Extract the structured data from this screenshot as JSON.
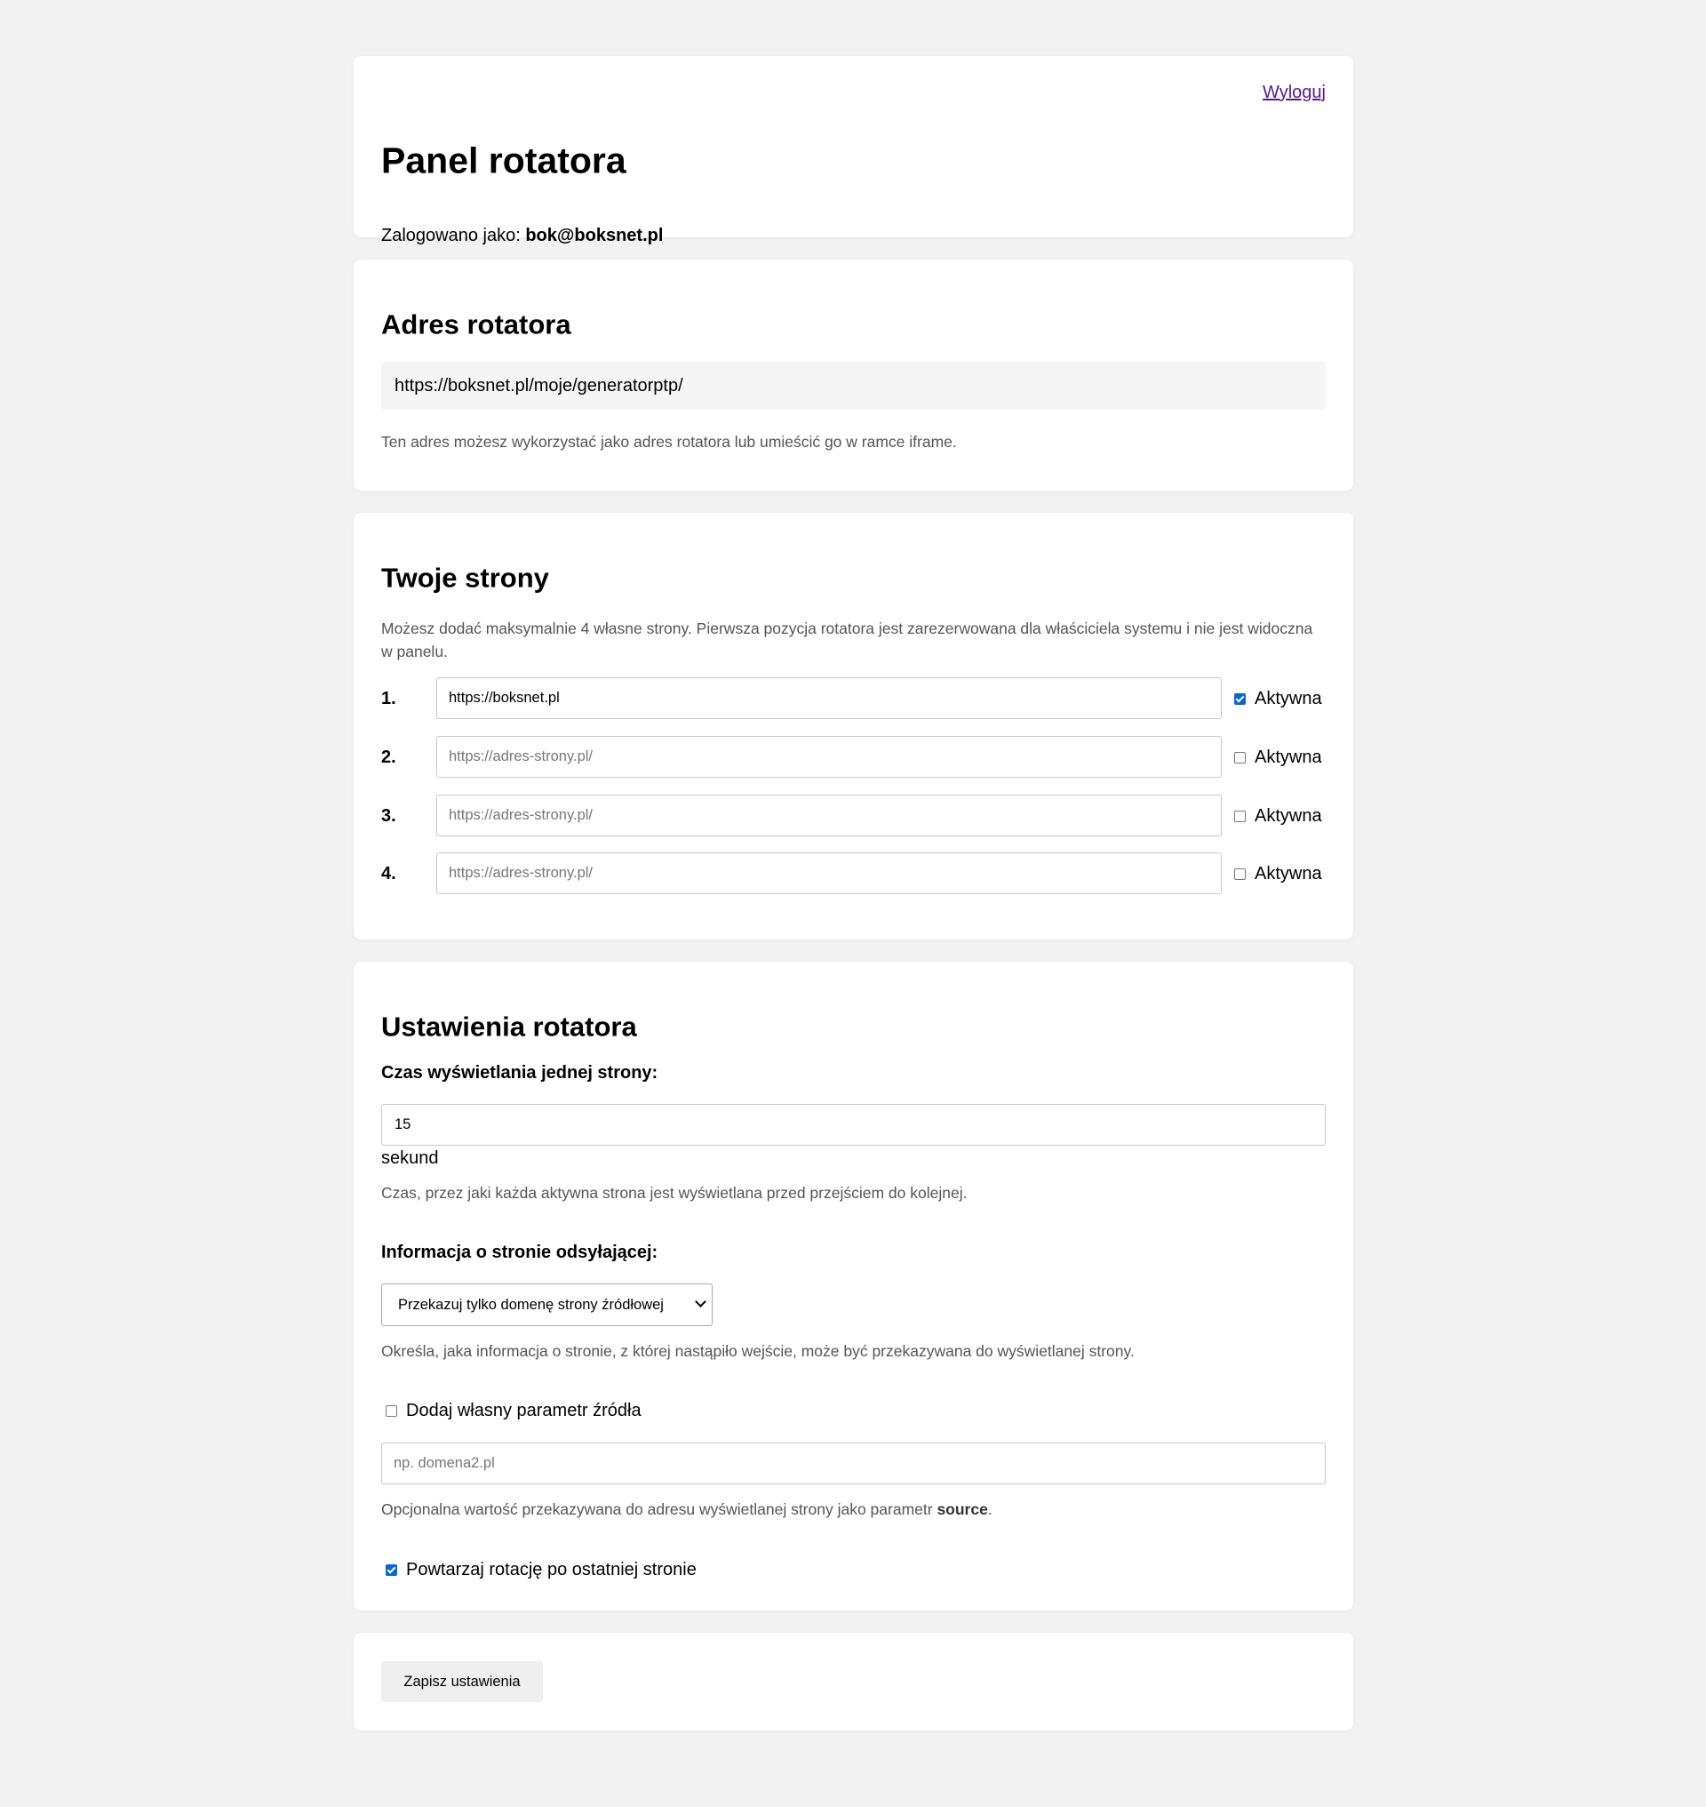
{
  "header": {
    "title": "Panel rotatora",
    "logged_in_prefix": "Zalogowano jako: ",
    "user_email": "bok@boksnet.pl",
    "logout_label": "Wyloguj"
  },
  "address": {
    "title": "Adres rotatora",
    "url": "https://boksnet.pl/moje/generatorptp/",
    "help": "Ten adres możesz wykorzystać jako adres rotatora lub umieścić go w ramce iframe."
  },
  "sites": {
    "title": "Twoje strony",
    "help": "Możesz dodać maksymalnie 4 własne strony. Pierwsza pozycja rotatora jest zarezerwowana dla właściciela systemu i nie jest widoczna w panelu.",
    "active_label": "Aktywna",
    "placeholder": "https://adres-strony.pl/",
    "items": [
      {
        "num": "1.",
        "value": "https://boksnet.pl",
        "active": true
      },
      {
        "num": "2.",
        "value": "",
        "active": false
      },
      {
        "num": "3.",
        "value": "",
        "active": false
      },
      {
        "num": "4.",
        "value": "",
        "active": false
      }
    ]
  },
  "settings": {
    "title": "Ustawienia rotatora",
    "time_label": "Czas wyświetlania jednej strony:",
    "time_value": "15",
    "time_unit": "sekund",
    "time_help": "Czas, przez jaki każda aktywna strona jest wyświetlana przed przejściem do kolejnej.",
    "referrer_label": "Informacja o stronie odsyłającej:",
    "referrer_selected": "Przekazuj tylko domenę strony źródłowej",
    "referrer_help": "Określa, jaka informacja o stronie, z której nastąpiło wejście, może być przekazywana do wyświetlanej strony.",
    "source_check_label": "Dodaj własny parametr źródła",
    "source_checked": false,
    "source_placeholder": "np. domena2.pl",
    "source_help_prefix": "Opcjonalna wartość przekazywana do adresu wyświetlanej strony jako parametr ",
    "source_help_param": "source",
    "source_help_suffix": ".",
    "repeat_label": "Powtarzaj rotację po ostatniej stronie",
    "repeat_checked": true
  },
  "save": {
    "label": "Zapisz ustawienia"
  },
  "colors": {
    "background": "#f2f2f2",
    "card": "#ffffff",
    "checkbox_accent": "#0a66d6",
    "link": "#551a8b"
  }
}
